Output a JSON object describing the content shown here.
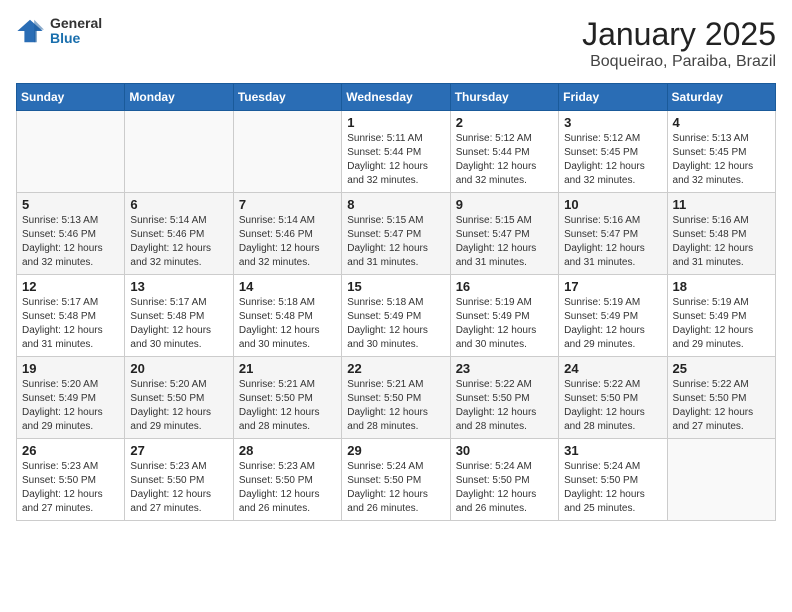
{
  "header": {
    "logo_general": "General",
    "logo_blue": "Blue",
    "month": "January 2025",
    "location": "Boqueirao, Paraiba, Brazil"
  },
  "weekdays": [
    "Sunday",
    "Monday",
    "Tuesday",
    "Wednesday",
    "Thursday",
    "Friday",
    "Saturday"
  ],
  "weeks": [
    [
      {
        "day": "",
        "info": ""
      },
      {
        "day": "",
        "info": ""
      },
      {
        "day": "",
        "info": ""
      },
      {
        "day": "1",
        "info": "Sunrise: 5:11 AM\nSunset: 5:44 PM\nDaylight: 12 hours\nand 32 minutes."
      },
      {
        "day": "2",
        "info": "Sunrise: 5:12 AM\nSunset: 5:44 PM\nDaylight: 12 hours\nand 32 minutes."
      },
      {
        "day": "3",
        "info": "Sunrise: 5:12 AM\nSunset: 5:45 PM\nDaylight: 12 hours\nand 32 minutes."
      },
      {
        "day": "4",
        "info": "Sunrise: 5:13 AM\nSunset: 5:45 PM\nDaylight: 12 hours\nand 32 minutes."
      }
    ],
    [
      {
        "day": "5",
        "info": "Sunrise: 5:13 AM\nSunset: 5:46 PM\nDaylight: 12 hours\nand 32 minutes."
      },
      {
        "day": "6",
        "info": "Sunrise: 5:14 AM\nSunset: 5:46 PM\nDaylight: 12 hours\nand 32 minutes."
      },
      {
        "day": "7",
        "info": "Sunrise: 5:14 AM\nSunset: 5:46 PM\nDaylight: 12 hours\nand 32 minutes."
      },
      {
        "day": "8",
        "info": "Sunrise: 5:15 AM\nSunset: 5:47 PM\nDaylight: 12 hours\nand 31 minutes."
      },
      {
        "day": "9",
        "info": "Sunrise: 5:15 AM\nSunset: 5:47 PM\nDaylight: 12 hours\nand 31 minutes."
      },
      {
        "day": "10",
        "info": "Sunrise: 5:16 AM\nSunset: 5:47 PM\nDaylight: 12 hours\nand 31 minutes."
      },
      {
        "day": "11",
        "info": "Sunrise: 5:16 AM\nSunset: 5:48 PM\nDaylight: 12 hours\nand 31 minutes."
      }
    ],
    [
      {
        "day": "12",
        "info": "Sunrise: 5:17 AM\nSunset: 5:48 PM\nDaylight: 12 hours\nand 31 minutes."
      },
      {
        "day": "13",
        "info": "Sunrise: 5:17 AM\nSunset: 5:48 PM\nDaylight: 12 hours\nand 30 minutes."
      },
      {
        "day": "14",
        "info": "Sunrise: 5:18 AM\nSunset: 5:48 PM\nDaylight: 12 hours\nand 30 minutes."
      },
      {
        "day": "15",
        "info": "Sunrise: 5:18 AM\nSunset: 5:49 PM\nDaylight: 12 hours\nand 30 minutes."
      },
      {
        "day": "16",
        "info": "Sunrise: 5:19 AM\nSunset: 5:49 PM\nDaylight: 12 hours\nand 30 minutes."
      },
      {
        "day": "17",
        "info": "Sunrise: 5:19 AM\nSunset: 5:49 PM\nDaylight: 12 hours\nand 29 minutes."
      },
      {
        "day": "18",
        "info": "Sunrise: 5:19 AM\nSunset: 5:49 PM\nDaylight: 12 hours\nand 29 minutes."
      }
    ],
    [
      {
        "day": "19",
        "info": "Sunrise: 5:20 AM\nSunset: 5:49 PM\nDaylight: 12 hours\nand 29 minutes."
      },
      {
        "day": "20",
        "info": "Sunrise: 5:20 AM\nSunset: 5:50 PM\nDaylight: 12 hours\nand 29 minutes."
      },
      {
        "day": "21",
        "info": "Sunrise: 5:21 AM\nSunset: 5:50 PM\nDaylight: 12 hours\nand 28 minutes."
      },
      {
        "day": "22",
        "info": "Sunrise: 5:21 AM\nSunset: 5:50 PM\nDaylight: 12 hours\nand 28 minutes."
      },
      {
        "day": "23",
        "info": "Sunrise: 5:22 AM\nSunset: 5:50 PM\nDaylight: 12 hours\nand 28 minutes."
      },
      {
        "day": "24",
        "info": "Sunrise: 5:22 AM\nSunset: 5:50 PM\nDaylight: 12 hours\nand 28 minutes."
      },
      {
        "day": "25",
        "info": "Sunrise: 5:22 AM\nSunset: 5:50 PM\nDaylight: 12 hours\nand 27 minutes."
      }
    ],
    [
      {
        "day": "26",
        "info": "Sunrise: 5:23 AM\nSunset: 5:50 PM\nDaylight: 12 hours\nand 27 minutes."
      },
      {
        "day": "27",
        "info": "Sunrise: 5:23 AM\nSunset: 5:50 PM\nDaylight: 12 hours\nand 27 minutes."
      },
      {
        "day": "28",
        "info": "Sunrise: 5:23 AM\nSunset: 5:50 PM\nDaylight: 12 hours\nand 26 minutes."
      },
      {
        "day": "29",
        "info": "Sunrise: 5:24 AM\nSunset: 5:50 PM\nDaylight: 12 hours\nand 26 minutes."
      },
      {
        "day": "30",
        "info": "Sunrise: 5:24 AM\nSunset: 5:50 PM\nDaylight: 12 hours\nand 26 minutes."
      },
      {
        "day": "31",
        "info": "Sunrise: 5:24 AM\nSunset: 5:50 PM\nDaylight: 12 hours\nand 25 minutes."
      },
      {
        "day": "",
        "info": ""
      }
    ]
  ]
}
